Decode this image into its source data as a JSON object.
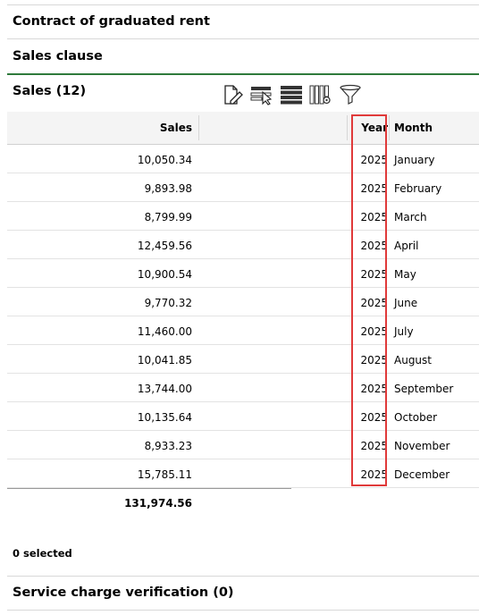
{
  "sections": {
    "contract_title": "Contract of graduated rent",
    "sales_clause_title": "Sales clause",
    "sales_title": "Sales (12)",
    "service_charge_title": "Service charge verification (0)"
  },
  "toolbar": {
    "icons": [
      "edit-document-icon",
      "row-select-icon",
      "list-view-icon",
      "column-settings-icon",
      "filter-icon"
    ]
  },
  "grid": {
    "columns": {
      "sales": "Sales",
      "year": "Year",
      "month": "Month"
    },
    "rows": [
      {
        "sales": "10,050.34",
        "year": "2025",
        "month": "January"
      },
      {
        "sales": "9,893.98",
        "year": "2025",
        "month": "February"
      },
      {
        "sales": "8,799.99",
        "year": "2025",
        "month": "March"
      },
      {
        "sales": "12,459.56",
        "year": "2025",
        "month": "April"
      },
      {
        "sales": "10,900.54",
        "year": "2025",
        "month": "May"
      },
      {
        "sales": "9,770.32",
        "year": "2025",
        "month": "June"
      },
      {
        "sales": "11,460.00",
        "year": "2025",
        "month": "July"
      },
      {
        "sales": "10,041.85",
        "year": "2025",
        "month": "August"
      },
      {
        "sales": "13,744.00",
        "year": "2025",
        "month": "September"
      },
      {
        "sales": "10,135.64",
        "year": "2025",
        "month": "October"
      },
      {
        "sales": "8,933.23",
        "year": "2025",
        "month": "November"
      },
      {
        "sales": "15,785.11",
        "year": "2025",
        "month": "December"
      }
    ],
    "total": "131,974.56",
    "selected_text": "0 selected"
  },
  "colors": {
    "accent_green": "#2f7a3c",
    "highlight_red": "#e03a3a"
  }
}
